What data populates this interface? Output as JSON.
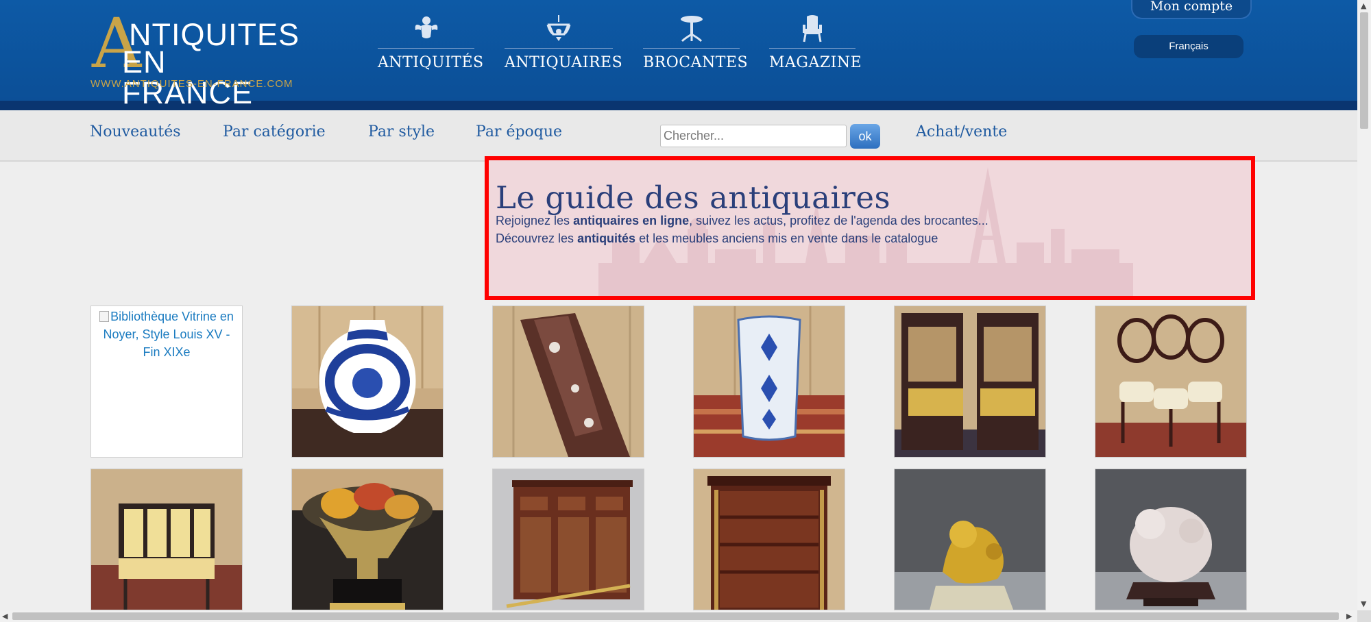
{
  "logo": {
    "initial": "A",
    "line1": "NTIQUITES",
    "line2": "EN FRANCE",
    "url": "WWW.ANTIQUITES-EN-FRANCE.COM"
  },
  "main_nav": [
    {
      "label": "ANTIQUITÉS",
      "icon": "cherub-icon"
    },
    {
      "label": "ANTIQUAIRES",
      "icon": "chandelier-icon"
    },
    {
      "label": "BROCANTES",
      "icon": "pedestal-table-icon"
    },
    {
      "label": "MAGAZINE",
      "icon": "armchair-icon"
    }
  ],
  "account": {
    "label": "Mon compte",
    "language": "Français"
  },
  "sub_nav": {
    "links": [
      "Nouveautés",
      "Par catégorie",
      "Par style",
      "Par époque"
    ],
    "search_placeholder": "Chercher...",
    "search_button": "ok",
    "achat_vente": "Achat/vente"
  },
  "hero": {
    "title": "Le guide des antiquaires",
    "line1": {
      "pre": "Rejoignez les ",
      "bold": "antiquaires en ligne",
      "post": ", suivez les actus, profitez de l'agenda des brocantes..."
    },
    "line2": {
      "pre": "Découvrez les ",
      "bold": "antiquités",
      "post": " et les meubles anciens mis en vente dans le catalogue"
    }
  },
  "products": {
    "broken_image_alt": "Bibliothèque Vitrine en Noyer, Style Louis XV - Fin XIXe",
    "row1": [
      "vase",
      "marble-console",
      "umbrella-stand",
      "cane-chairs",
      "balloon-chairs"
    ],
    "row2": [
      "yellow-chairs",
      "fruit-bowl",
      "bar-cabinet",
      "bookcase",
      "gilt-lion",
      "quartz-carving"
    ]
  },
  "colors": {
    "header_blue": "#0d5aa6",
    "gold": "#c9a448",
    "link_blue": "#1f5aa0",
    "highlight_border": "#ff0000"
  }
}
